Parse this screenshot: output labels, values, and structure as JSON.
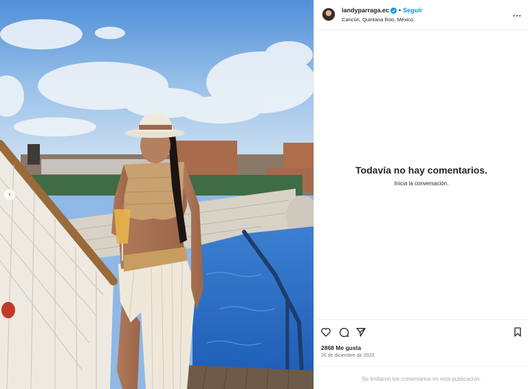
{
  "header": {
    "username": "landyparraga.ec",
    "separator": "•",
    "follow_label": "Seguir",
    "location": "Cancún, Quintana Roo, México.",
    "more_label": "..."
  },
  "comments": {
    "empty_title": "Todavía no hay comentarios.",
    "empty_subtitle": "Inicia la conversación."
  },
  "footer": {
    "likes": "2868 Me gusta",
    "date": "26 de diciembre de 2023",
    "comments_limited": "Se limitaron los comentarios en esta publicación."
  },
  "icons": {
    "like": "heart-icon",
    "comment": "comment-icon",
    "share": "share-icon",
    "save": "bookmark-icon",
    "verified": "verified-badge-icon"
  },
  "colors": {
    "accent": "#0095f6",
    "text": "#262626",
    "muted": "#737373",
    "faint": "#a8a8a8"
  }
}
